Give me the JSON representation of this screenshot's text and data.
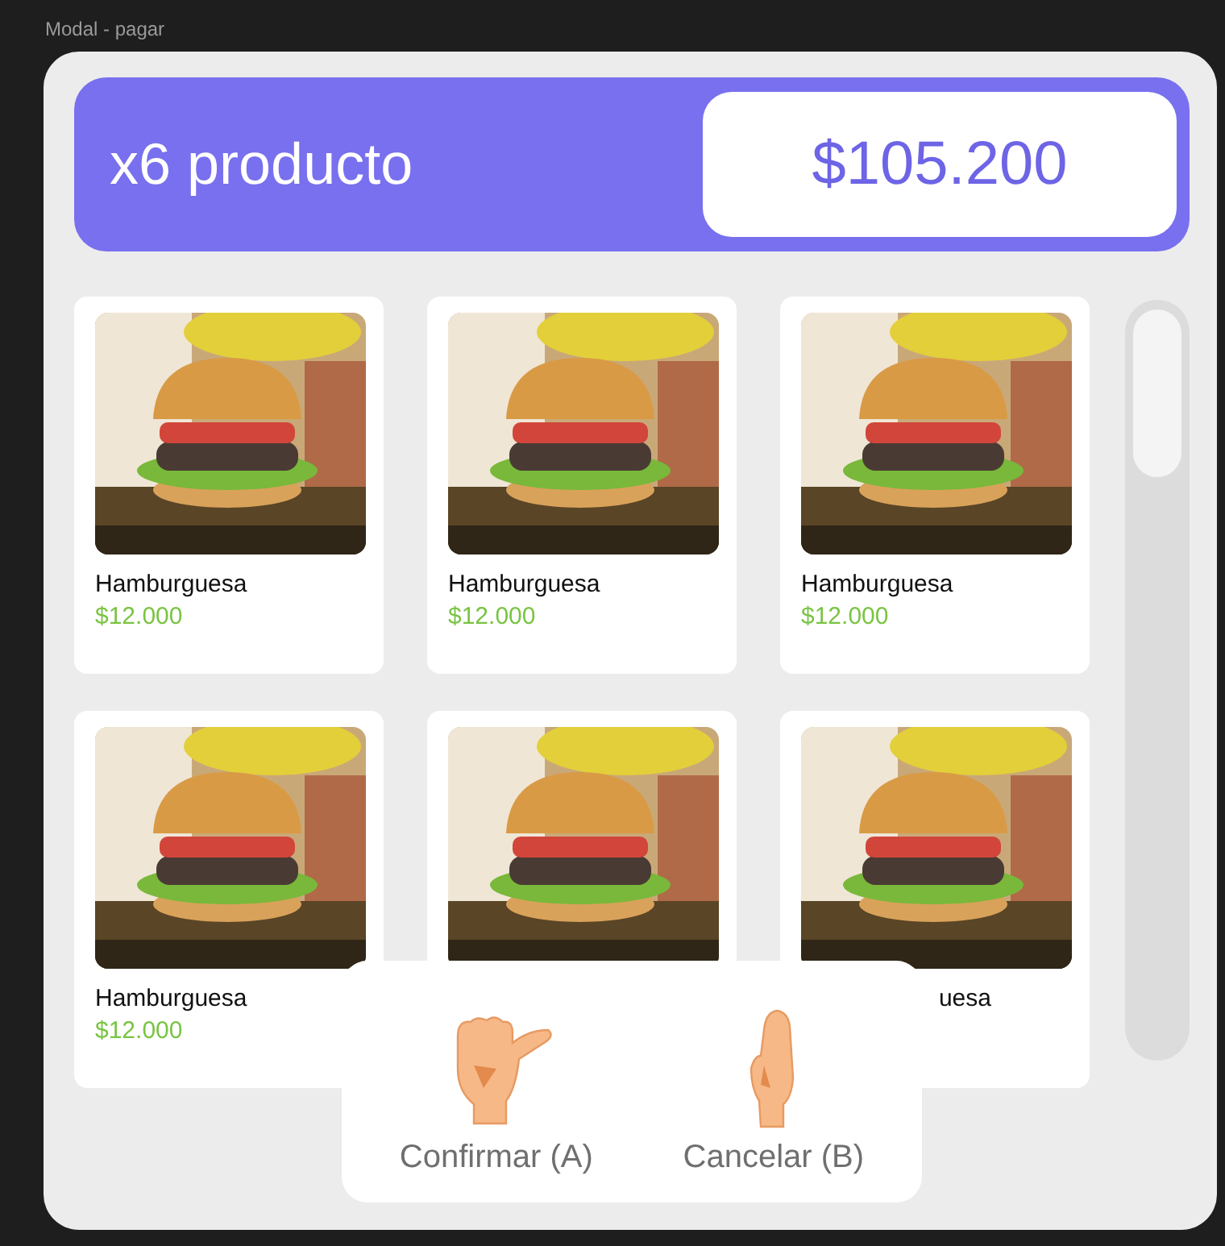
{
  "frame_label": "Modal - pagar",
  "header": {
    "title": "x6 producto",
    "total": "$105.200"
  },
  "products": [
    {
      "kind": "full",
      "name": "Hamburguesa",
      "price": "$12.000"
    },
    {
      "kind": "full",
      "name": "Hamburguesa",
      "price": "$12.000"
    },
    {
      "kind": "full",
      "name": "Hamburguesa",
      "price": "$12.000"
    },
    {
      "kind": "full",
      "name": "Hamburguesa",
      "price": "$12.000"
    },
    {
      "kind": "covered"
    },
    {
      "kind": "partial",
      "name": "uesa"
    }
  ],
  "actions": [
    {
      "kind": "confirm",
      "label": "Confirmar (A)"
    },
    {
      "kind": "cancel",
      "label": "Cancelar (B)"
    }
  ]
}
